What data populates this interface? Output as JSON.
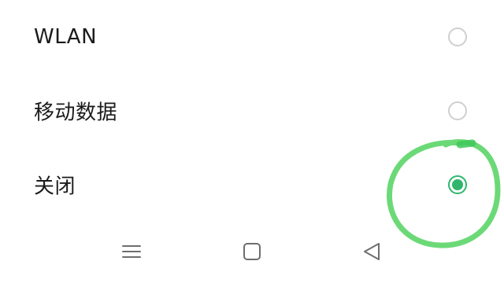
{
  "options": [
    {
      "label": "WLAN",
      "selected": false
    },
    {
      "label": "移动数据",
      "selected": false
    },
    {
      "label": "关闭",
      "selected": true
    }
  ],
  "colors": {
    "accent": "#2fb66c",
    "radio_border": "#cfcfcf",
    "text": "#1b1b1b",
    "annotation": "#5fd66b",
    "nav_icon": "#6e6e6e"
  },
  "navbar": {
    "icons": [
      "menu-icon",
      "home-square-icon",
      "back-triangle-icon"
    ]
  }
}
